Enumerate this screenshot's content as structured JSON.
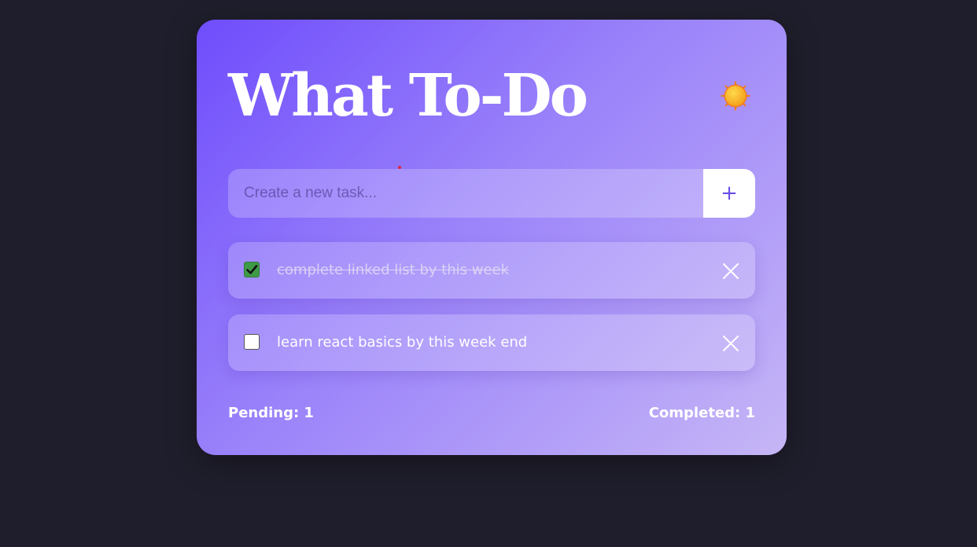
{
  "app": {
    "title": "What To-Do",
    "theme_toggle_icon": "sun-icon"
  },
  "new_task": {
    "placeholder": "Create a new task...",
    "value": "",
    "add_label": "+"
  },
  "tasks": [
    {
      "text": "complete linked list by this week",
      "completed": true
    },
    {
      "text": "learn react basics by this week end",
      "completed": false
    }
  ],
  "stats": {
    "pending": "Pending: 1",
    "completed": "Completed: 1"
  },
  "colors": {
    "background": "#1f1e2c",
    "card_gradient_start": "#6f4dfc",
    "card_gradient_end": "#c6b6f6",
    "accent": "#6a4ee8",
    "checkbox_checked": "#3f9a47"
  }
}
